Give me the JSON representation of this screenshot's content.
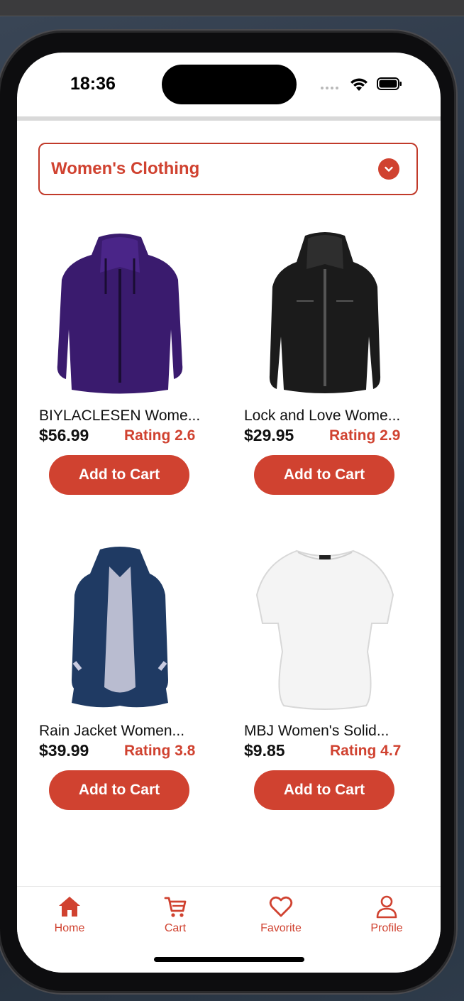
{
  "status": {
    "time": "18:36"
  },
  "category": {
    "selected": "Women's Clothing"
  },
  "products": [
    {
      "title": "BIYLACLESEN Wome...",
      "price": "$56.99",
      "rating": "Rating 2.6",
      "button": "Add to Cart"
    },
    {
      "title": "Lock and Love Wome...",
      "price": "$29.95",
      "rating": "Rating 2.9",
      "button": "Add to Cart"
    },
    {
      "title": "Rain Jacket Women...",
      "price": "$39.99",
      "rating": "Rating 3.8",
      "button": "Add to Cart"
    },
    {
      "title": "MBJ Women's Solid...",
      "price": "$9.85",
      "rating": "Rating 4.7",
      "button": "Add to Cart"
    }
  ],
  "tabbar": [
    {
      "label": "Home",
      "icon": "home-icon"
    },
    {
      "label": "Cart",
      "icon": "cart-icon"
    },
    {
      "label": "Favorite",
      "icon": "heart-icon"
    },
    {
      "label": "Profile",
      "icon": "person-icon"
    }
  ],
  "colors": {
    "accent": "#d04230",
    "text": "#111111"
  }
}
